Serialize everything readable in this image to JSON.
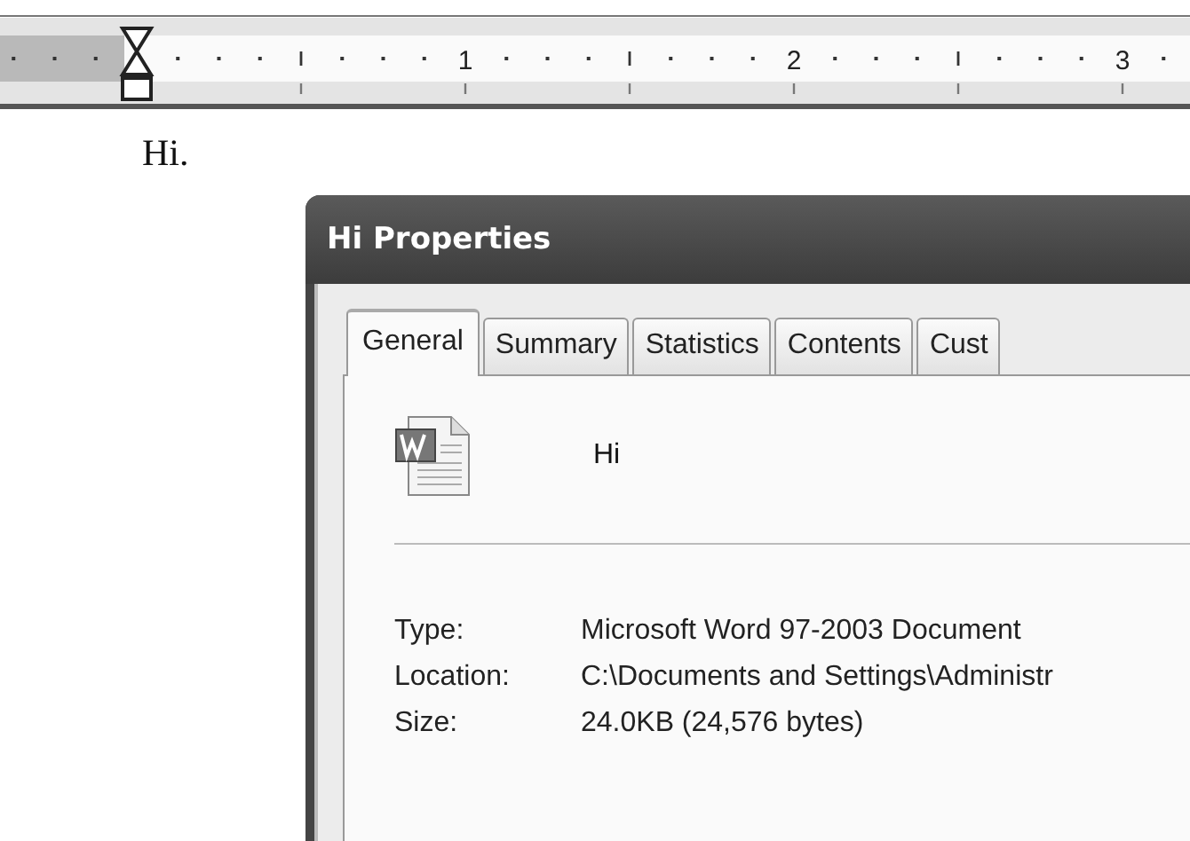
{
  "ruler": {
    "numbers": [
      "1",
      "2",
      "3"
    ]
  },
  "document": {
    "text": "Hi."
  },
  "dialog": {
    "title": "Hi Properties",
    "tabs": [
      {
        "label": "General",
        "selected": true
      },
      {
        "label": "Summary",
        "selected": false
      },
      {
        "label": "Statistics",
        "selected": false
      },
      {
        "label": "Contents",
        "selected": false
      },
      {
        "label": "Cust",
        "selected": false
      }
    ],
    "file_name": "Hi",
    "properties": [
      {
        "label": "Type:",
        "value": "Microsoft Word 97-2003 Document"
      },
      {
        "label": "Location:",
        "value": "C:\\Documents and Settings\\Administr"
      },
      {
        "label": "Size:",
        "value": "24.0KB (24,576 bytes)"
      }
    ]
  }
}
